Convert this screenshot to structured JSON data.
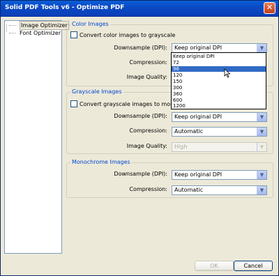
{
  "window": {
    "title": "Solid PDF Tools v6 - Optimize PDF"
  },
  "tree": {
    "items": [
      "Image Optimizer",
      "Font Optimizer"
    ]
  },
  "color_images": {
    "title": "Color Images",
    "convert_label": "Convert color images to grayscale",
    "convert_checked": false,
    "downsample_label": "Downsample (DPI):",
    "downsample_value": "Keep original DPI",
    "compression_label": "Compression:",
    "image_quality_label": "Image Quality:"
  },
  "dpi_dropdown": {
    "options": [
      "Keep original DPI",
      "72",
      "96",
      "120",
      "150",
      "300",
      "360",
      "600",
      "1200"
    ],
    "highlighted": "96"
  },
  "grayscale_images": {
    "title": "Grayscale Images",
    "convert_label": "Convert grayscale images to monochrome",
    "convert_checked": false,
    "downsample_label": "Downsample (DPI):",
    "downsample_value": "Keep original DPI",
    "compression_label": "Compression:",
    "compression_value": "Automatic",
    "image_quality_label": "Image Quality:",
    "image_quality_value": "High"
  },
  "monochrome_images": {
    "title": "Monochrome Images",
    "downsample_label": "Downsample (DPI):",
    "downsample_value": "Keep original DPI",
    "compression_label": "Compression:",
    "compression_value": "Automatic"
  },
  "buttons": {
    "ok": "OK",
    "cancel": "Cancel"
  },
  "colors": {
    "title_bar": "#0a4ac5",
    "group_title": "#0046d5",
    "highlight": "#316ac5",
    "window_bg": "#ece9d8"
  }
}
